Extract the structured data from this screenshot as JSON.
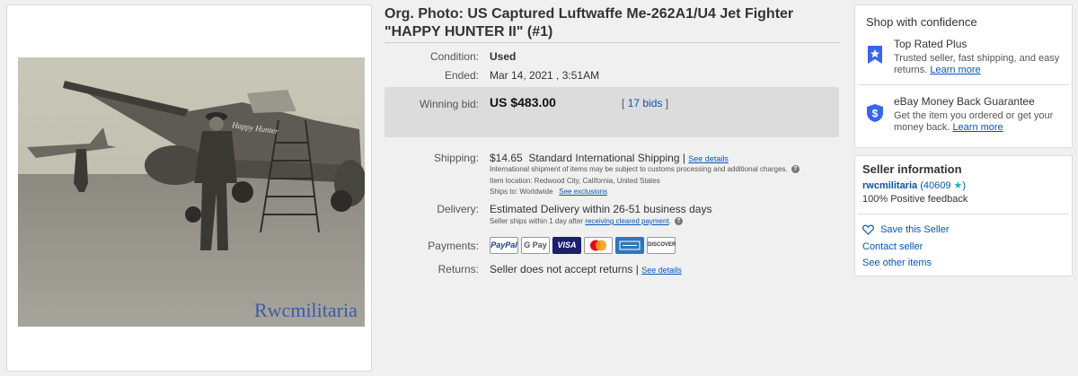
{
  "listing": {
    "title": "Org. Photo: US Captured Luftwaffe Me-262A1/U4 Jet Fighter \"HAPPY HUNTER II\" (#1)",
    "watermark": "Rwcmilitaria",
    "plane_nose_text": "Happy Hunter"
  },
  "details": {
    "condition_label": "Condition:",
    "condition_value": "Used",
    "ended_label": "Ended:",
    "ended_value": "Mar 14, 2021 , 3:51AM",
    "winning_bid_label": "Winning bid:",
    "winning_bid_value": "US $483.00",
    "bids_open": "[",
    "bids_link": "17 bids",
    "bids_close": "]"
  },
  "shipping": {
    "label": "Shipping:",
    "cost": "$14.65",
    "method": "Standard International Shipping |",
    "see_details": "See details",
    "note": "International shipment of items may be subject to customs processing and additional charges.",
    "item_location": "Item location:  Redwood City, California, United States",
    "ships_to_label": "Ships to:  Worldwide",
    "see_exclusions": "See exclusions"
  },
  "delivery": {
    "label": "Delivery:",
    "estimate": "Estimated Delivery within 26-51 business days",
    "note_prefix": "Seller ships within 1 day after",
    "note_link": "receiving cleared payment",
    "note_suffix": "."
  },
  "payments": {
    "label": "Payments:",
    "methods": [
      "PayPal",
      "G Pay",
      "VISA",
      "",
      "",
      "DISCOVER"
    ]
  },
  "returns": {
    "label": "Returns:",
    "policy": "Seller does not accept returns |",
    "see_details": "See details"
  },
  "confidence": {
    "title": "Shop with confidence",
    "top_rated_title": "Top Rated Plus",
    "top_rated_text": "Trusted seller, fast shipping, and easy returns.",
    "top_rated_link": "Learn more",
    "guarantee_title": "eBay Money Back Guarantee",
    "guarantee_text": "Get the item you ordered or get your money back.",
    "guarantee_link": "Learn more"
  },
  "seller": {
    "heading": "Seller information",
    "name": "rwcmilitaria",
    "feedback_count": "(40609",
    "feedback_close": ")",
    "positive": "100% Positive feedback",
    "save_seller": "Save this Seller",
    "contact": "Contact seller",
    "other_items": "See other items"
  },
  "colors": {
    "link": "#0654ba",
    "badge_blue": "#3665f3",
    "star_teal": "#17b5b5"
  }
}
